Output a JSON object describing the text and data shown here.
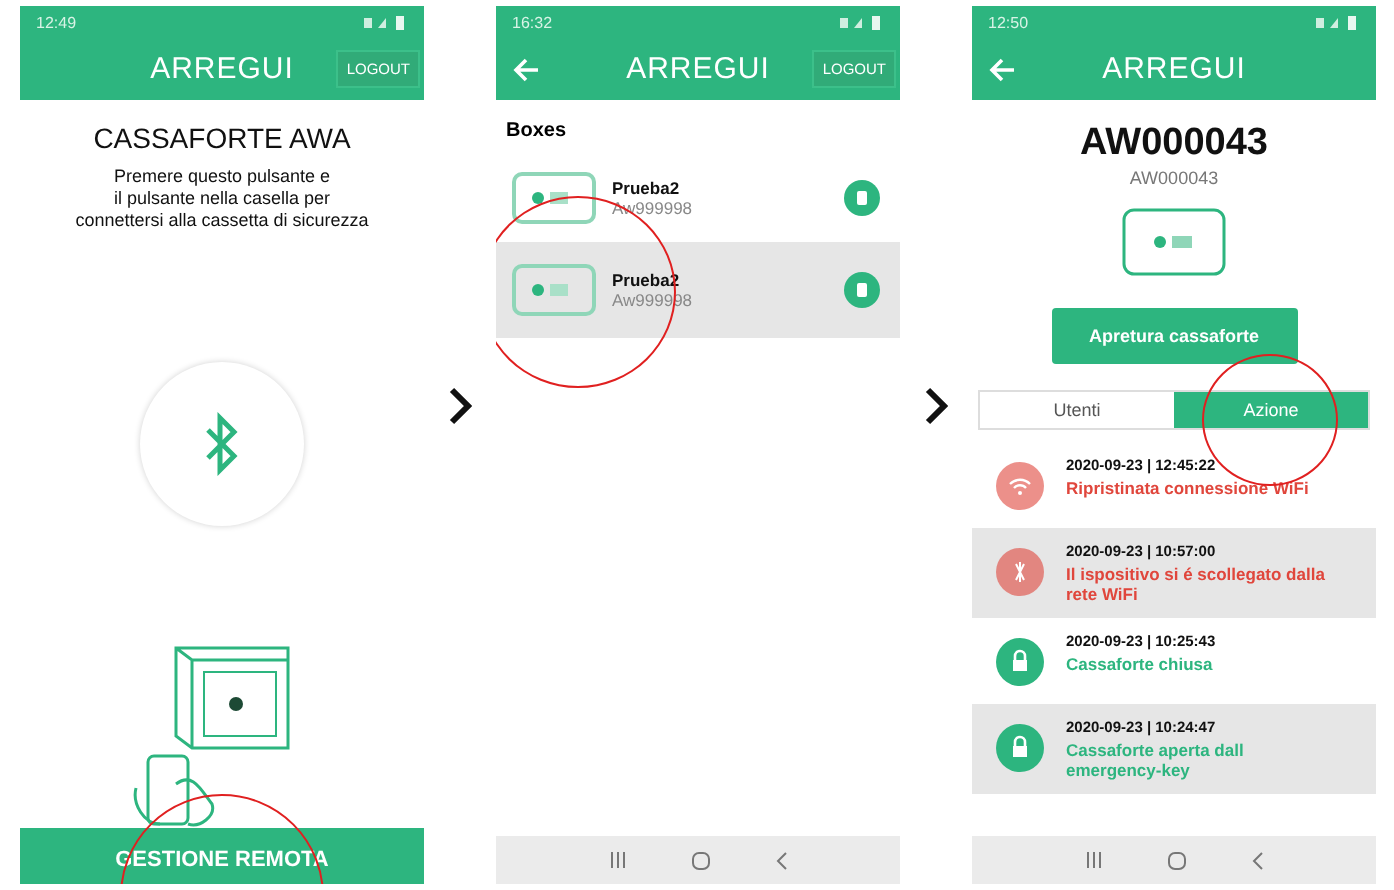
{
  "screens": [
    {
      "kind": "connect",
      "status_time": "12:49",
      "header": {
        "back": false,
        "logo": "ARREGUI",
        "logout": "LOGOUT"
      },
      "title": "CASSAFORTE AWA",
      "description": "Premere questo pulsante e\nil pulsante nella casella per\nconnettersi alla cassetta di sicurezza",
      "action_button": "GESTIONE REMOTA"
    },
    {
      "kind": "boxes",
      "status_time": "16:32",
      "header": {
        "back": true,
        "logo": "ARREGUI",
        "logout": "LOGOUT"
      },
      "section_title": "Boxes",
      "boxes": [
        {
          "name": "Prueba2",
          "code": "Aw999998",
          "selected": false
        },
        {
          "name": "Prueba2",
          "code": "Aw999998",
          "selected": true
        }
      ]
    },
    {
      "kind": "detail",
      "status_time": "12:50",
      "header": {
        "back": true,
        "logo": "ARREGUI"
      },
      "title": "AW000043",
      "subtitle": "AW000043",
      "action_button": "Apretura cassaforte",
      "tabs": [
        {
          "label": "Utenti",
          "selected": false
        },
        {
          "label": "Azione",
          "selected": true
        }
      ],
      "events": [
        {
          "kind": "wifi",
          "time": "2020-09-23 | 12:45:22",
          "message": "Ripristinata connessione WiFi",
          "color": "#e0463c"
        },
        {
          "kind": "wifi-off",
          "time": "2020-09-23 | 10:57:00",
          "message": "Il ispositivo si é scollegato dalla rete WiFi",
          "color": "#e0463c"
        },
        {
          "kind": "lock",
          "time": "2020-09-23 | 10:25:43",
          "message": "Cassaforte chiusa",
          "color": "#2db57f"
        },
        {
          "kind": "lock",
          "time": "2020-09-23 | 10:24:47",
          "message": "Cassaforte aperta dall emergency-key",
          "color": "#2db57f"
        }
      ]
    }
  ]
}
